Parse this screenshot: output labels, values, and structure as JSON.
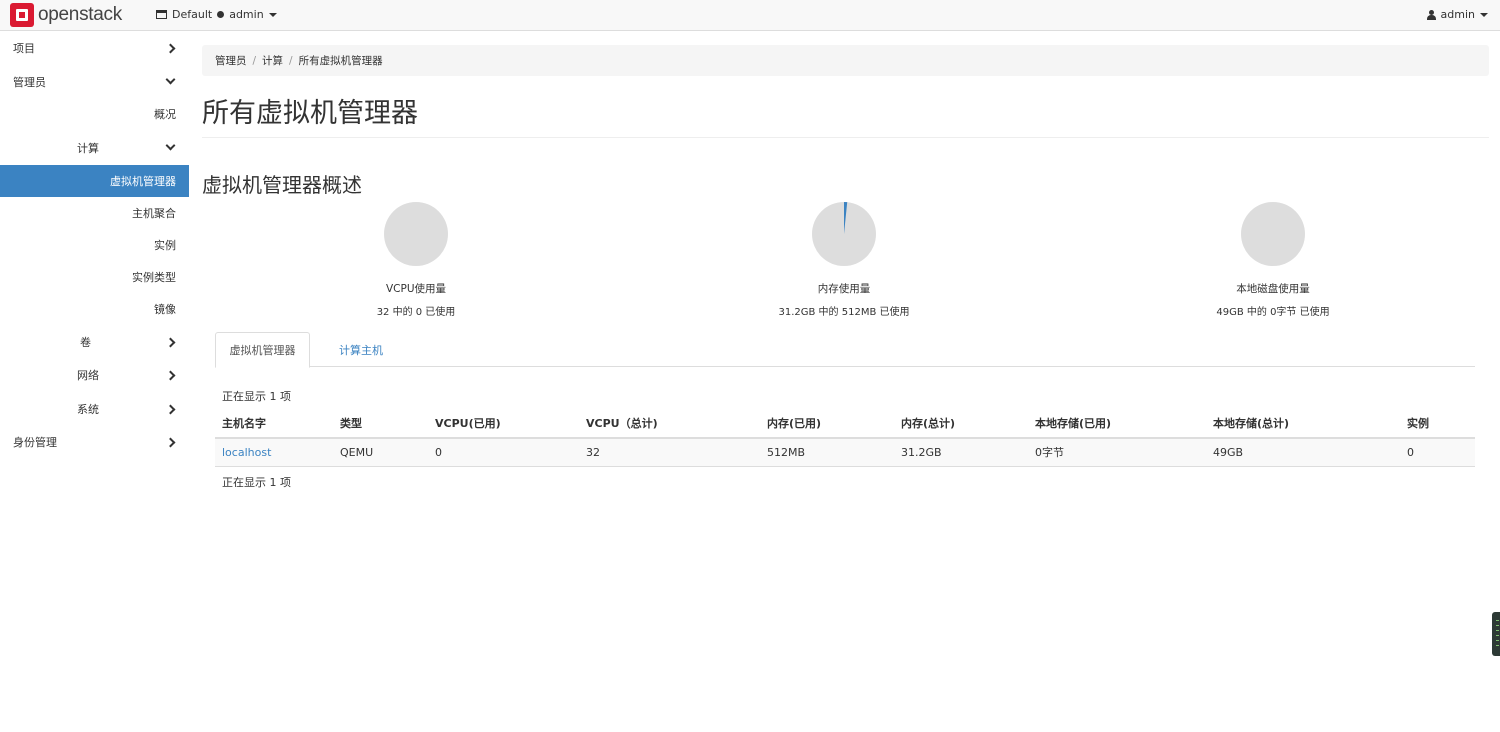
{
  "navbar": {
    "brand": "openstack",
    "domain": "Default",
    "project": "admin",
    "user": "admin"
  },
  "sidebar": {
    "items": [
      {
        "label": "项目"
      },
      {
        "label": "管理员"
      },
      {
        "label": "概况"
      },
      {
        "label": "计算"
      },
      {
        "label": "虚拟机管理器"
      },
      {
        "label": "主机聚合"
      },
      {
        "label": "实例"
      },
      {
        "label": "实例类型"
      },
      {
        "label": "镜像"
      },
      {
        "label": "卷"
      },
      {
        "label": "网络"
      },
      {
        "label": "系统"
      },
      {
        "label": "身份管理"
      }
    ]
  },
  "breadcrumb": [
    "管理员",
    "计算",
    "所有虚拟机管理器"
  ],
  "page_title": "所有虚拟机管理器",
  "section_title": "虚拟机管理器概述",
  "usage": [
    {
      "label": "VCPU使用量",
      "detail": "32 中的 0 已使用",
      "fraction": 0.0
    },
    {
      "label": "内存使用量",
      "detail": "31.2GB 中的 512MB 已使用",
      "fraction": 0.016
    },
    {
      "label": "本地磁盘使用量",
      "detail": "49GB 中的 0字节 已使用",
      "fraction": 0.0
    }
  ],
  "colors": {
    "accent": "#3b83c2",
    "pie_bg": "#dddddd"
  },
  "tabs": [
    {
      "label": "虚拟机管理器"
    },
    {
      "label": "计算主机"
    }
  ],
  "count_text": "正在显示 1 项",
  "table": {
    "headers": [
      "主机名字",
      "类型",
      "VCPU(已用)",
      "VCPU（总计)",
      "内存(已用)",
      "内存(总计)",
      "本地存储(已用)",
      "本地存储(总计)",
      "实例"
    ],
    "rows": [
      [
        "localhost",
        "QEMU",
        "0",
        "32",
        "512MB",
        "31.2GB",
        "0字节",
        "49GB",
        "0"
      ]
    ]
  }
}
